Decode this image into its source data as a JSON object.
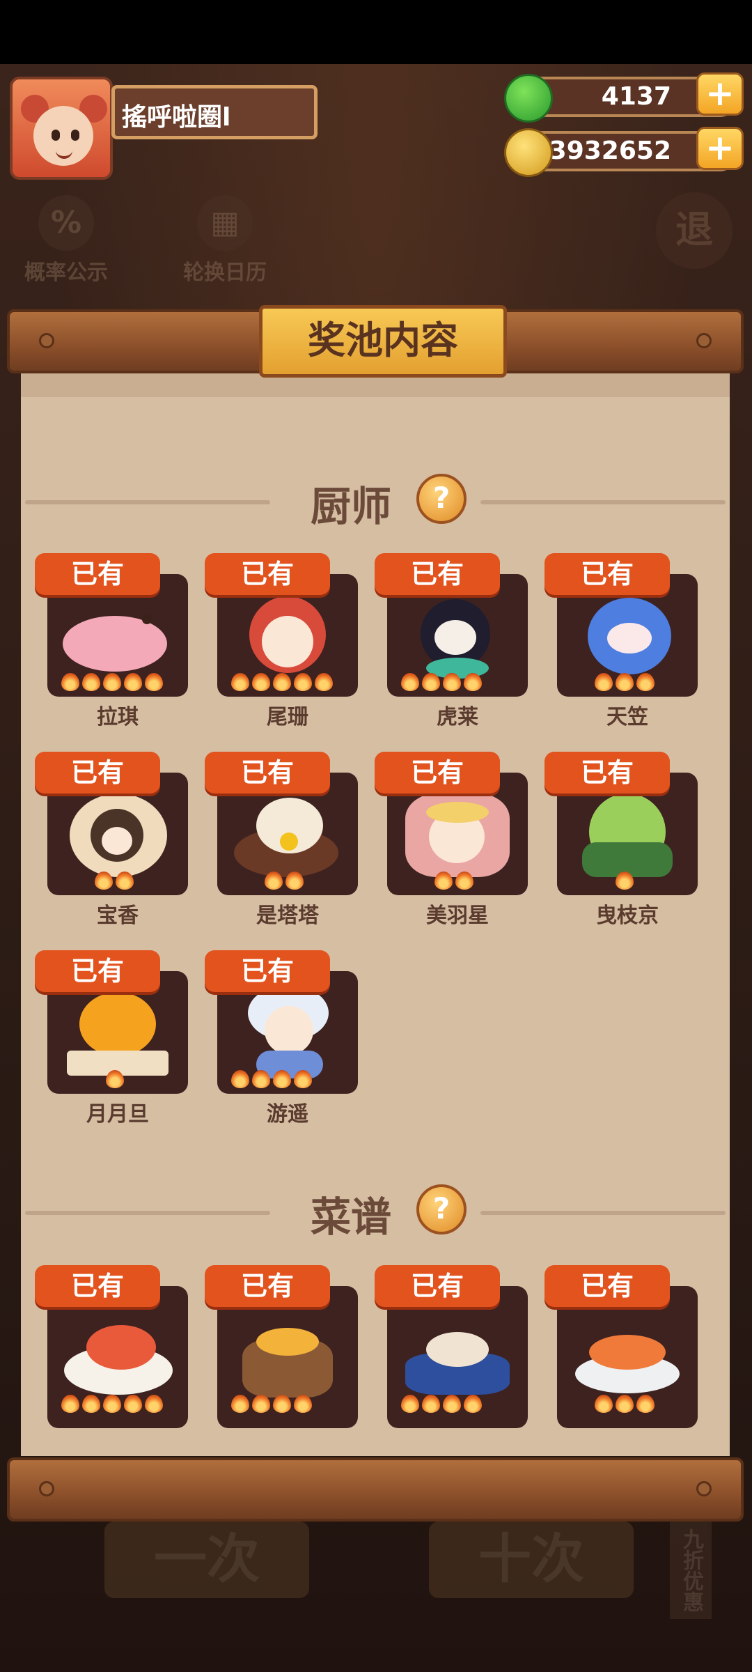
{
  "player": {
    "name": "搖呼啦圈l"
  },
  "currency": {
    "jade": "4137",
    "coins": "13932652",
    "plus": "+"
  },
  "menu": {
    "probability": "概率公示",
    "calendar": "轮换日历",
    "exit": "退"
  },
  "panel": {
    "title": "奖池内容",
    "chef_section": "厨师",
    "recipe_section": "菜谱",
    "help": "?"
  },
  "chefs": [
    {
      "name": "拉琪",
      "badge": "已有",
      "stars": 5
    },
    {
      "name": "尾珊",
      "badge": "已有",
      "stars": 5
    },
    {
      "name": "虎莱",
      "badge": "已有",
      "stars": 4
    },
    {
      "name": "天笠",
      "badge": "已有",
      "stars": 3
    },
    {
      "name": "宝香",
      "badge": "已有",
      "stars": 2
    },
    {
      "name": "是塔塔",
      "badge": "已有",
      "stars": 2
    },
    {
      "name": "美羽星",
      "badge": "已有",
      "stars": 2
    },
    {
      "name": "曳枝京",
      "badge": "已有",
      "stars": 1
    },
    {
      "name": "月月旦",
      "badge": "已有",
      "stars": 1
    },
    {
      "name": "游遥",
      "badge": "已有",
      "stars": 4
    }
  ],
  "recipes": [
    {
      "badge": "已有",
      "stars": 5
    },
    {
      "badge": "已有",
      "stars": 4
    },
    {
      "badge": "已有",
      "stars": 4
    },
    {
      "badge": "已有",
      "stars": 3
    }
  ],
  "bottom": {
    "once": "一次",
    "ten": "十次",
    "discount": "九折优惠"
  },
  "colors": {
    "badge": "#e2531e",
    "panel": "#d6bea3",
    "card": "#3e2220"
  }
}
